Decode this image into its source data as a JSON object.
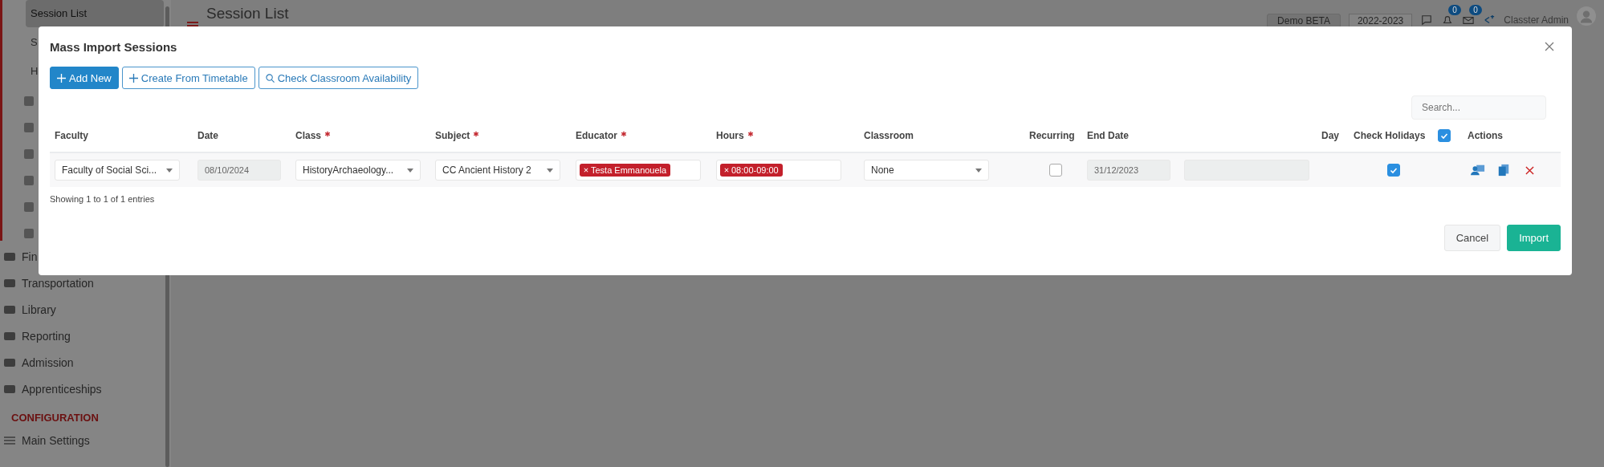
{
  "sidebar": {
    "submenu": [
      {
        "label": "Session List",
        "selected": true
      },
      {
        "label": "S",
        "selected": false
      },
      {
        "label": "H",
        "selected": false
      }
    ],
    "modules": [
      {
        "label": "Fin"
      },
      {
        "label": "Transportation"
      },
      {
        "label": "Library"
      },
      {
        "label": "Reporting"
      },
      {
        "label": "Admission"
      },
      {
        "label": "Apprenticeships"
      }
    ],
    "section_heading": "CONFIGURATION",
    "settings": [
      {
        "label": "Main Settings"
      }
    ]
  },
  "topbar": {
    "title": "Session List",
    "environment": "Demo BETA",
    "year": "2022-2023",
    "notification_count": "0",
    "message_count": "0",
    "user": "Classter Admin"
  },
  "modal": {
    "title": "Mass Import Sessions",
    "toolbar": [
      {
        "label": "Add New",
        "kind": "primary"
      },
      {
        "label": "Create From Timetable",
        "kind": "outline"
      },
      {
        "label": "Check Classroom Availability",
        "kind": "search"
      }
    ],
    "search": {
      "placeholder": "Search..."
    },
    "columns": [
      {
        "kind": "text",
        "label": "Faculty",
        "required": false
      },
      {
        "kind": "text",
        "label": "Date",
        "required": false
      },
      {
        "kind": "text",
        "label": "Class",
        "required": true
      },
      {
        "kind": "text",
        "label": "Subject",
        "required": true
      },
      {
        "kind": "text",
        "label": "Educator",
        "required": true
      },
      {
        "kind": "text",
        "label": "Hours",
        "required": true
      },
      {
        "kind": "text",
        "label": "Classroom",
        "required": false
      },
      {
        "kind": "text",
        "label": "Recurring",
        "required": false
      },
      {
        "kind": "text",
        "label": "End Date",
        "required": false
      },
      {
        "kind": "blank"
      },
      {
        "kind": "text",
        "label": "Day",
        "required": false
      },
      {
        "kind": "text",
        "label": "Check Holidays",
        "required": false
      },
      {
        "kind": "checkbox",
        "checked": true
      },
      {
        "kind": "text",
        "label": "Actions",
        "required": false
      }
    ],
    "rows": [
      {
        "faculty": "Faculty of Social Sci...",
        "date": "08/10/2024",
        "class": "HistoryArchaeology...",
        "subject": "CC Ancient History 2",
        "educators": [
          "Testa Emmanouela"
        ],
        "hours": [
          "08:00-09:00"
        ],
        "classroom": "None",
        "recurring": false,
        "end_date": "31/12/2023",
        "check_holidays": true
      }
    ],
    "info": "Showing 1 to 1 of 1 entries",
    "buttons": [
      {
        "label": "Cancel",
        "kind": "secondary"
      },
      {
        "label": "Import",
        "kind": "success"
      }
    ]
  }
}
